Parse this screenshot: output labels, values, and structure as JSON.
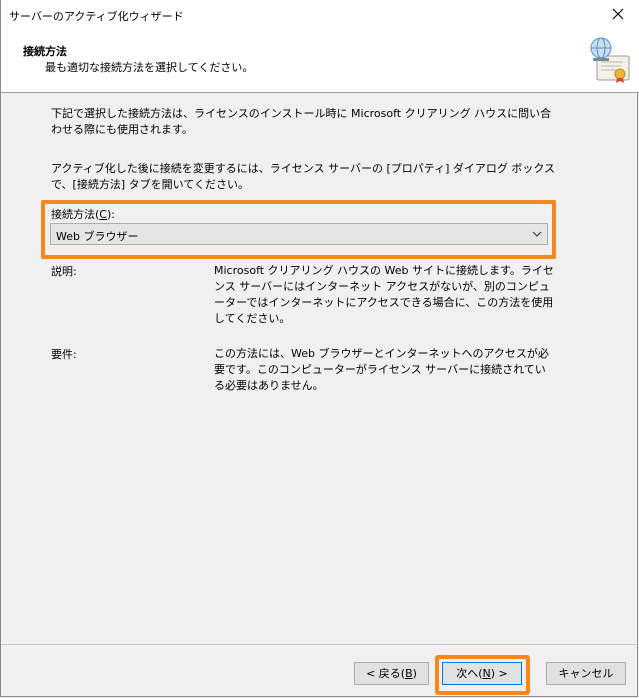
{
  "window": {
    "title": "サーバーのアクティブ化ウィザード"
  },
  "header": {
    "title": "接続方法",
    "subtitle": "最も適切な接続方法を選択してください。"
  },
  "intro": {
    "p1": "下記で選択した接続方法は、ライセンスのインストール時に Microsoft クリアリング ハウスに問い合わせる際にも使用されます。",
    "p2": "アクティブ化した後に接続を変更するには、ライセンス サーバーの [プロパティ] ダイアログ ボックスで、[接続方法] タブを開いてください。"
  },
  "connection": {
    "label_prefix": "接続方法(",
    "label_key": "C",
    "label_suffix": "):",
    "selected": "Web ブラウザー"
  },
  "description": {
    "label": "説明:",
    "text": "Microsoft クリアリング ハウスの Web サイトに接続します。ライセンス サーバーにはインターネット アクセスがないが、別のコンピューターではインターネットにアクセスできる場合に、この方法を使用してください。"
  },
  "requirements": {
    "label": "要件:",
    "text": "この方法には、Web ブラウザーとインターネットへのアクセスが必要です。このコンピューターがライセンス サーバーに接続されている必要はありません。"
  },
  "buttons": {
    "back_prefix": "< 戻る(",
    "back_key": "B",
    "back_suffix": ")",
    "next_prefix": "次へ(",
    "next_key": "N",
    "next_suffix": ") >",
    "cancel": "キャンセル"
  },
  "colors": {
    "highlight": "#f5871f",
    "focus": "#0078d7"
  }
}
